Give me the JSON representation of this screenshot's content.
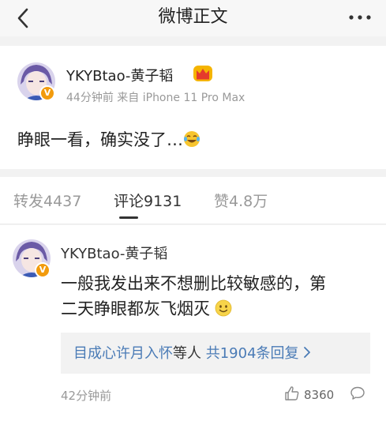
{
  "nav": {
    "title": "微博正文",
    "back_icon": "chevron-left-icon",
    "more_icon": "more-horizontal-icon"
  },
  "post": {
    "author": "YKYBtao-黄子韬",
    "time": "44分钟前",
    "source": "来自 iPhone 11 Pro Max",
    "text": "睁眼一看，确实没了…",
    "badge_icon": "crown-icon",
    "emoji_icon": "laugh-cry-emoji-icon"
  },
  "tabs": {
    "repost": "转发4437",
    "comments": "评论9131",
    "likes": "赞4.8万",
    "active": "comments"
  },
  "comment": {
    "author": "YKYBtao-黄子韬",
    "text_line1": "一般我发出来不想删比较敏感的，第",
    "text_line2": "二天睁眼都灰飞烟灭",
    "emoji_icon": "smile-emoji-icon",
    "reply_names": "目成心许月入怀",
    "reply_mid": "等人",
    "reply_total": "共1904条回复",
    "time": "42分钟前",
    "like_count": "8360"
  },
  "colors": {
    "link": "#4a7bb6",
    "verified_badge": "#f29b0d",
    "background": "#f2f2f2"
  }
}
